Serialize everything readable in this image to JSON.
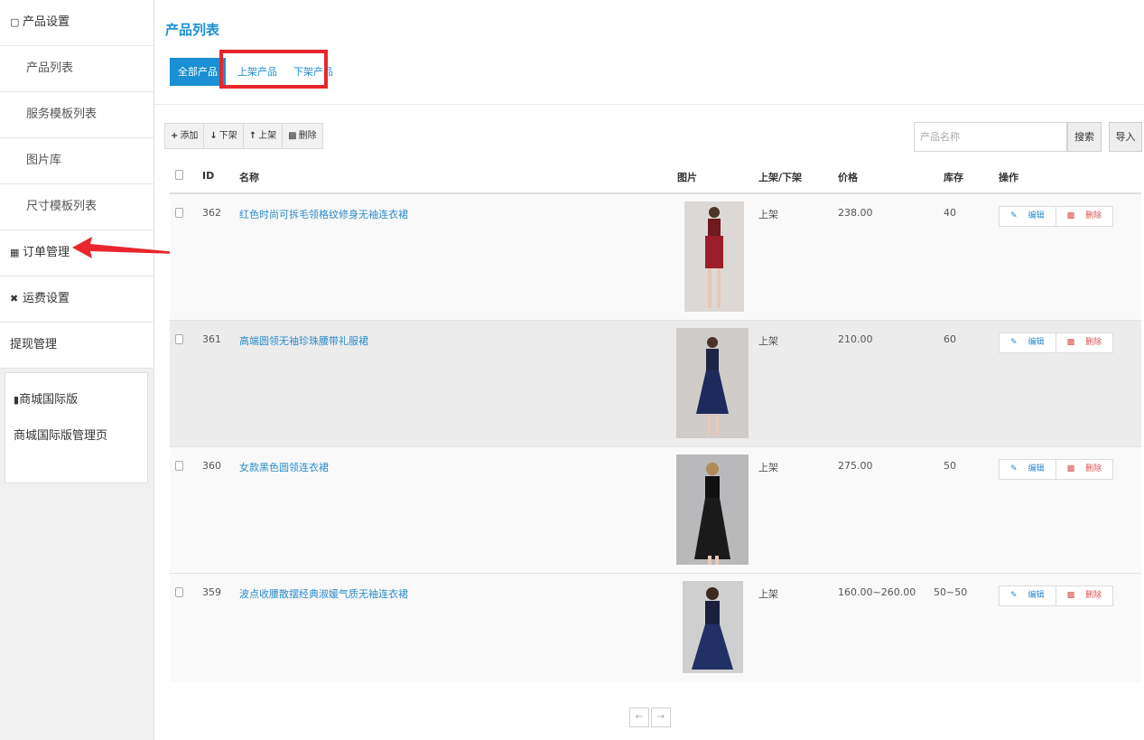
{
  "sidebar": {
    "product_settings": "产品设置",
    "items": [
      "产品列表",
      "服务模板列表",
      "图片库",
      "尺寸模板列表"
    ],
    "order_mgmt": "订单管理",
    "shipping": "运费设置",
    "withdraw": "提现管理",
    "card_title": "商城国际版",
    "card_link": "商城国际版管理页"
  },
  "main": {
    "title": "产品列表",
    "tabs": [
      "全部产品",
      "上架产品",
      "下架产品"
    ],
    "toolbar": {
      "add": "添加",
      "down": "下架",
      "up": "上架",
      "del": "删除"
    },
    "search_placeholder": "产品名称",
    "search_btn": "搜索",
    "import_btn": "导入"
  },
  "table": {
    "headers": {
      "id": "ID",
      "name": "名称",
      "image": "图片",
      "status": "上架/下架",
      "price": "价格",
      "stock": "库存",
      "ops": "操作"
    },
    "rows": [
      {
        "id": "362",
        "name": "红色时尚可拆毛领格纹修身无袖连衣裙",
        "status": "上架",
        "price": "238.00",
        "stock": "40"
      },
      {
        "id": "361",
        "name": "高端圆领无袖珍珠腰带礼服裙",
        "status": "上架",
        "price": "210.00",
        "stock": "60"
      },
      {
        "id": "360",
        "name": "女款黑色圆领连衣裙",
        "status": "上架",
        "price": "275.00",
        "stock": "50"
      },
      {
        "id": "359",
        "name": "波点收腰散摆经典淑媛气质无袖连衣裙",
        "status": "上架",
        "price": "160.00~260.00",
        "stock": "50~50"
      }
    ],
    "edit_label": "编辑",
    "delete_label": "删除"
  },
  "pager": {
    "prev": "←",
    "next": "→"
  },
  "colors": {
    "accent": "#1b8fd3",
    "highlight": "#e8262c",
    "danger": "#d9534f"
  }
}
